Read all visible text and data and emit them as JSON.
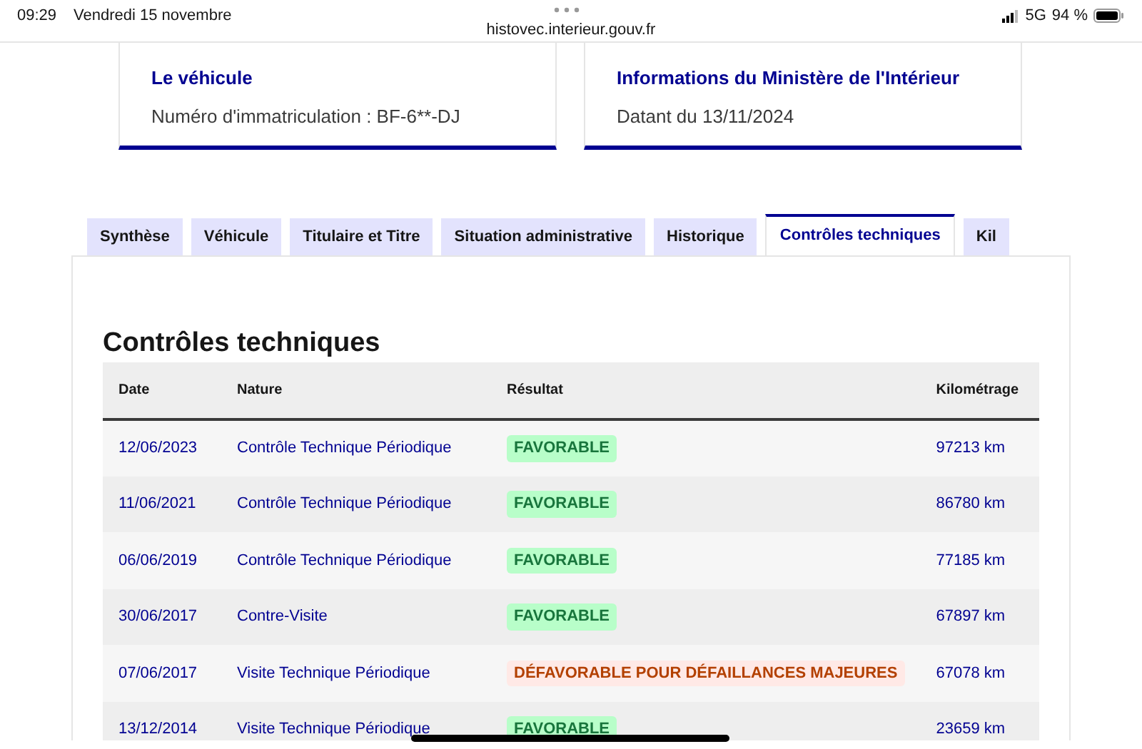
{
  "status_bar": {
    "time": "09:29",
    "date": "Vendredi 15 novembre",
    "network": "5G",
    "battery": "94 %"
  },
  "address_bar": {
    "url": "histovec.interieur.gouv.fr"
  },
  "cards": [
    {
      "title": "Le véhicule",
      "text": "Numéro d'immatriculation : BF-6**-DJ"
    },
    {
      "title": "Informations du Ministère de l'Intérieur",
      "text": "Datant du 13/11/2024"
    }
  ],
  "tabs": [
    {
      "label": "Synthèse",
      "selected": false
    },
    {
      "label": "Véhicule",
      "selected": false
    },
    {
      "label": "Titulaire et Titre",
      "selected": false
    },
    {
      "label": "Situation administrative",
      "selected": false
    },
    {
      "label": "Historique",
      "selected": false
    },
    {
      "label": "Contrôles techniques",
      "selected": true
    },
    {
      "label": "Kil",
      "selected": false
    }
  ],
  "section_title": "Contrôles techniques",
  "table": {
    "columns": [
      "Date",
      "Nature",
      "Résultat",
      "Kilométrage"
    ],
    "rows": [
      {
        "date": "12/06/2023",
        "nature": "Contrôle Technique Périodique",
        "result": {
          "kind": "favorable",
          "label": "FAVORABLE"
        },
        "mileage": "97213 km"
      },
      {
        "date": "11/06/2021",
        "nature": "Contrôle Technique Périodique",
        "result": {
          "kind": "favorable",
          "label": "FAVORABLE"
        },
        "mileage": "86780 km"
      },
      {
        "date": "06/06/2019",
        "nature": "Contrôle Technique Périodique",
        "result": {
          "kind": "favorable",
          "label": "FAVORABLE"
        },
        "mileage": "77185 km"
      },
      {
        "date": "30/06/2017",
        "nature": "Contre-Visite",
        "result": {
          "kind": "favorable",
          "label": "FAVORABLE"
        },
        "mileage": "67897 km"
      },
      {
        "date": "07/06/2017",
        "nature": "Visite Technique Périodique",
        "result": {
          "kind": "unfavorable",
          "label": "DÉFAVORABLE POUR DÉFAILLANCES MAJEURES"
        },
        "mileage": "67078 km"
      },
      {
        "date": "13/12/2014",
        "nature": "Visite Technique Périodique",
        "result": {
          "kind": "favorable",
          "label": "FAVORABLE"
        },
        "mileage": "23659 km"
      }
    ]
  }
}
